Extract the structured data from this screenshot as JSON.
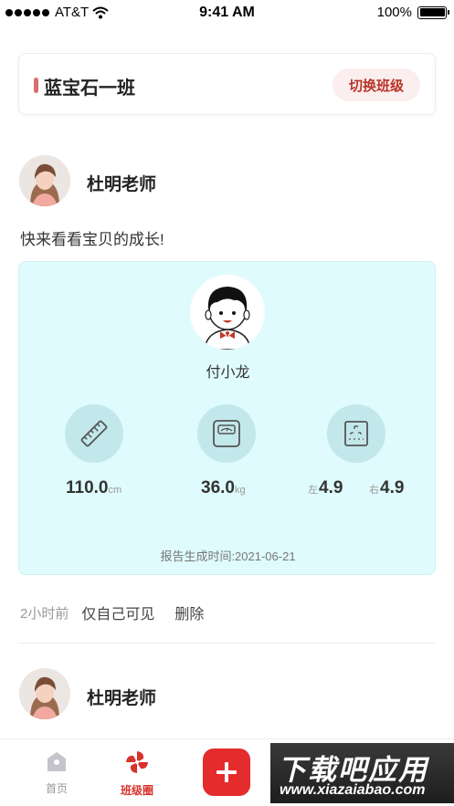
{
  "status_bar": {
    "carrier": "AT&T",
    "time": "9:41 AM",
    "battery": "100%"
  },
  "class_header": {
    "class_name": "蓝宝石一班",
    "switch_label": "切换班级"
  },
  "post": {
    "teacher_name": "杜明老师",
    "text": "快来看看宝贝的成长!",
    "report": {
      "kid_name": "付小龙",
      "height": {
        "value": "110.0",
        "unit": "cm"
      },
      "weight": {
        "value": "36.0",
        "unit": "kg"
      },
      "vision": {
        "left_label": "左",
        "left_value": "4.9",
        "right_label": "右",
        "right_value": "4.9"
      },
      "generated_time": "报告生成时间:2021-06-21"
    },
    "meta": {
      "time": "2小时前",
      "visibility": "仅自己可见",
      "delete": "删除"
    }
  },
  "next_post": {
    "teacher_name": "杜明老师"
  },
  "tab_bar": {
    "home": "首页",
    "class_circle": "班级圈",
    "accent": "#e42c2c"
  },
  "watermark": {
    "title": "下载吧应用",
    "url": "www.xiazaiabao.com"
  }
}
